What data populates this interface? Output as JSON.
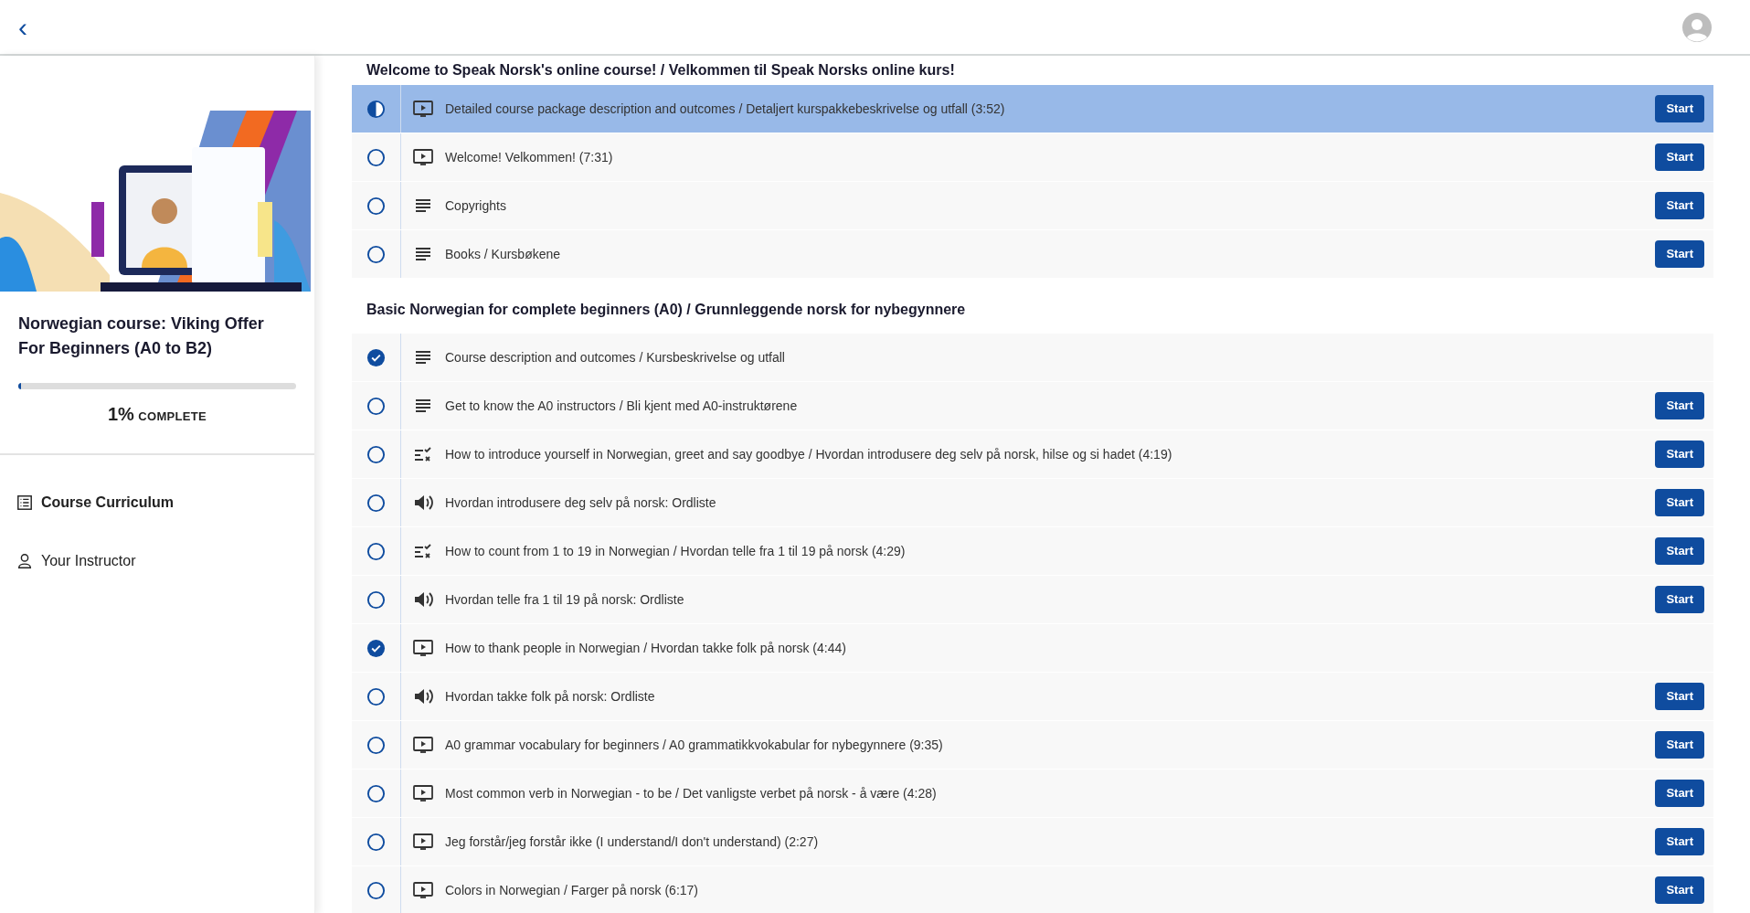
{
  "header": {
    "back": "‹"
  },
  "course": {
    "kind": "picture",
    "title": "Norwegian course: Viking Offer For Beginners (A0 to B2)",
    "level": 0.01,
    "percent": "1%",
    "complete_label": "COMPLETE"
  },
  "nav": [
    {
      "label": "Course Curriculum",
      "selected": true
    },
    {
      "label": "Your Instructor",
      "selected": false
    }
  ],
  "sections": [
    {
      "title": "Welcome to Speak Norsk's online course! / Velkommen til Speak Norsks online kurs!",
      "lectures": [
        {
          "kind": "video",
          "title": "Detailed course package description and outcomes / Detaljert kurspakkebeskrivelse og utfall (3:52)",
          "completed": false,
          "in_progress": true,
          "selected": true,
          "action": "Start"
        },
        {
          "kind": "video",
          "title": "Welcome! Velkommen! (7:31)",
          "completed": false,
          "in_progress": false,
          "selected": false,
          "action": "Start"
        },
        {
          "kind": "text",
          "title": "Copyrights",
          "completed": false,
          "in_progress": false,
          "selected": false,
          "action": "Start"
        },
        {
          "kind": "text",
          "title": "Books / Kursbøkene",
          "completed": false,
          "in_progress": false,
          "selected": false,
          "action": "Start"
        }
      ]
    },
    {
      "title": "Basic Norwegian for complete beginners (A0) / Grunnleggende norsk for nybegynnere",
      "lectures": [
        {
          "kind": "text",
          "title": "Course description and outcomes / Kursbeskrivelse og utfall",
          "completed": true,
          "in_progress": false,
          "selected": false
        },
        {
          "kind": "text",
          "title": "Get to know the A0 instructors / Bli kjent med A0-instruktørene",
          "completed": false,
          "in_progress": false,
          "selected": false,
          "action": "Start"
        },
        {
          "kind": "quiz",
          "title": "How to introduce yourself in Norwegian, greet and say goodbye / Hvordan introdusere deg selv på norsk, hilse og si hadet (4:19)",
          "completed": false,
          "in_progress": false,
          "selected": false,
          "action": "Start"
        },
        {
          "kind": "audio",
          "title": "Hvordan introdusere deg selv på norsk: Ordliste",
          "completed": false,
          "in_progress": false,
          "selected": false,
          "action": "Start"
        },
        {
          "kind": "quiz",
          "title": "How to count from 1 to 19 in Norwegian / Hvordan telle fra 1 til 19 på norsk (4:29)",
          "completed": false,
          "in_progress": false,
          "selected": false,
          "action": "Start"
        },
        {
          "kind": "audio",
          "title": "Hvordan telle fra 1 til 19 på norsk: Ordliste",
          "completed": false,
          "in_progress": false,
          "selected": false,
          "action": "Start"
        },
        {
          "kind": "video",
          "title": "How to thank people in Norwegian / Hvordan takke folk på norsk (4:44)",
          "completed": true,
          "in_progress": false,
          "selected": false
        },
        {
          "kind": "audio",
          "title": "Hvordan takke folk på norsk: Ordliste",
          "completed": false,
          "in_progress": false,
          "selected": false,
          "action": "Start"
        },
        {
          "kind": "video",
          "title": "A0 grammar vocabulary for beginners / A0 grammatikkvokabular for nybegynnere (9:35)",
          "completed": false,
          "in_progress": false,
          "selected": false,
          "action": "Start"
        },
        {
          "kind": "video",
          "title": "Most common verb in Norwegian - to be / Det vanligste verbet på norsk - å være (4:28)",
          "completed": false,
          "in_progress": false,
          "selected": false,
          "action": "Start"
        },
        {
          "kind": "video",
          "title": "Jeg forstår/jeg forstår ikke (I understand/I don't understand) (2:27)",
          "completed": false,
          "in_progress": false,
          "selected": false,
          "action": "Start"
        },
        {
          "kind": "video",
          "title": "Colors in Norwegian / Farger på norsk (6:17)",
          "completed": false,
          "in_progress": false,
          "selected": false,
          "action": "Start"
        }
      ]
    }
  ]
}
